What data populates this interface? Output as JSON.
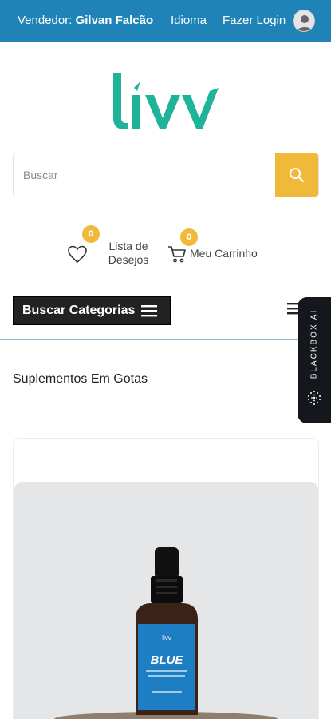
{
  "topbar": {
    "seller_prefix": "Vendedor:",
    "seller_name": "Gilvan Falcão",
    "language": "Idioma",
    "login": "Fazer Login"
  },
  "brand": {
    "logo_text": "livv",
    "color": "#1fb39a"
  },
  "search": {
    "placeholder": "Buscar"
  },
  "wishlist": {
    "count": "0",
    "label_line1": "Lista de",
    "label_line2": "Desejos"
  },
  "cart": {
    "count": "0",
    "label": "Meu Carrinho"
  },
  "categories": {
    "button_label": "Buscar Categorias"
  },
  "section": {
    "title": "Suplementos Em Gotas"
  },
  "product": {
    "bottle_brand": "livv",
    "bottle_name": "BLUE"
  },
  "assistant": {
    "label": "BLACKBOX AI"
  },
  "colors": {
    "topbar": "#1f83b8",
    "accent": "#f1b93a",
    "dark": "#222222"
  }
}
